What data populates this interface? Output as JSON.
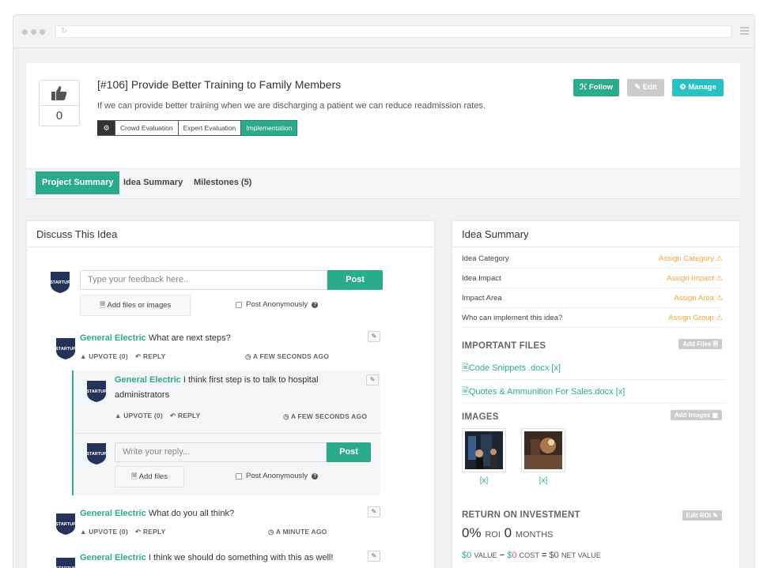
{
  "header": {
    "vote_count": "0",
    "title": "[#106] Provide Better Training to Family Members",
    "description": "If we can provide better training when we are discharging a patient we can reduce readmission rates.",
    "stages": [
      "Crowd Evaluation",
      "Expert Evaluation",
      "Implementation"
    ],
    "active_stage": "Implementation",
    "buttons": {
      "follow": "Follow",
      "edit": "Edit",
      "manage": "Manage"
    }
  },
  "tabs": [
    {
      "label": "Project Summary",
      "active": true
    },
    {
      "label": "Idea Summary",
      "active": false
    },
    {
      "label": "Milestones (5)",
      "active": false
    }
  ],
  "discuss": {
    "title": "Discuss This Idea",
    "feedback_placeholder": "Type your feedback here..",
    "post_label": "Post",
    "add_files_label": "Add files or images",
    "anonymous_label": "Post Anonymously",
    "avatar_text": "STARTUP",
    "comments": [
      {
        "author": "General Electric",
        "text": "What are next steps?",
        "upvote": "UPVOTE (0)",
        "reply": "REPLY",
        "time": "A FEW SECONDS AGO"
      },
      {
        "author": "General Electric",
        "text": "I think first step is to talk to hospital administrators",
        "upvote": "UPVOTE (0)",
        "reply": "REPLY",
        "time": "A FEW SECONDS AGO"
      },
      {
        "author": "General Electric",
        "text": "What do you all think?",
        "upvote": "UPVOTE (0)",
        "reply": "REPLY",
        "time": "A MINUTE AGO"
      },
      {
        "author": "General Electric",
        "text": "I think we should do something with this as well!"
      }
    ],
    "reply_box": {
      "placeholder": "Write your reply...",
      "post_label": "Post",
      "add_files_label": "Add files",
      "anonymous_label": "Post Anonymously"
    }
  },
  "summary": {
    "title": "Idea Summary",
    "rows": [
      {
        "label": "Idea Category",
        "action": "Assign Category"
      },
      {
        "label": "Idea Impact",
        "action": "Assign Impact"
      },
      {
        "label": "Impact Area",
        "action": "Assign Area"
      },
      {
        "label": "Who can implement this idea?",
        "action": "Assign Group"
      }
    ],
    "files_heading": "IMPORTANT FILES",
    "add_files_btn": "Add Files",
    "files": [
      "Code Snippets .docx [x]",
      "Quotes & Ammunition For Sales.docx [x]"
    ],
    "images_heading": "IMAGES",
    "add_images_btn": "Add Images",
    "image_remove": [
      "[x]",
      "[x]"
    ],
    "roi_heading": "RETURN ON INVESTMENT",
    "edit_roi_btn": "Edit ROI",
    "roi_pct": "0%",
    "roi_label": "ROI",
    "months_value": "0",
    "months_label": "MONTHS",
    "value_amount": "0",
    "value_label": "VALUE",
    "cost_amount": "0",
    "cost_label": "COST",
    "net_amount": "$0",
    "net_label": "NET VALUE"
  }
}
